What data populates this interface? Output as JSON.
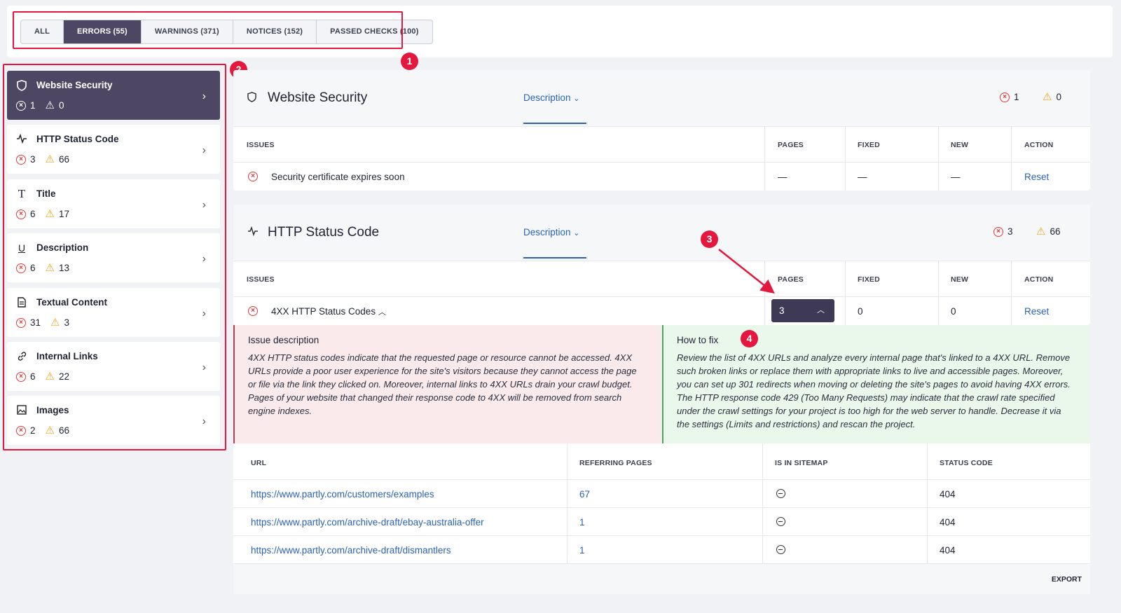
{
  "filter_tabs": [
    {
      "label": "ALL"
    },
    {
      "label": "ERRORS (55)"
    },
    {
      "label": "WARNINGS (371)"
    },
    {
      "label": "NOTICES (152)"
    },
    {
      "label": "PASSED CHECKS (100)"
    }
  ],
  "annotations": [
    "1",
    "2",
    "3",
    "4"
  ],
  "sidebar": {
    "items": [
      {
        "label": "Website Security",
        "icon": "shield-icon",
        "errors": "1",
        "warnings": "0"
      },
      {
        "label": "HTTP Status Code",
        "icon": "pulse-icon",
        "errors": "3",
        "warnings": "66"
      },
      {
        "label": "Title",
        "icon": "title-icon",
        "errors": "6",
        "warnings": "17"
      },
      {
        "label": "Description",
        "icon": "underline-icon",
        "errors": "6",
        "warnings": "13"
      },
      {
        "label": "Textual Content",
        "icon": "document-icon",
        "errors": "31",
        "warnings": "3"
      },
      {
        "label": "Internal Links",
        "icon": "link-icon",
        "errors": "6",
        "warnings": "22"
      },
      {
        "label": "Images",
        "icon": "image-icon",
        "errors": "2",
        "warnings": "66"
      }
    ]
  },
  "columns": {
    "issues": "ISSUES",
    "pages": "PAGES",
    "fixed": "FIXED",
    "new": "NEW",
    "action": "ACTION"
  },
  "panels": [
    {
      "title": "Website Security",
      "description_label": "Description",
      "errors": "1",
      "warnings": "0",
      "issue": {
        "name": "Security certificate expires soon",
        "pages": "—",
        "fixed": "—",
        "new": "—",
        "action": "Reset"
      }
    },
    {
      "title": "HTTP Status Code",
      "description_label": "Description",
      "errors": "3",
      "warnings": "66",
      "issue": {
        "name": "4XX HTTP Status Codes",
        "pages": "3",
        "fixed": "0",
        "new": "0",
        "action": "Reset"
      }
    }
  ],
  "issue_description": {
    "title": "Issue description",
    "lines": [
      "4XX HTTP status codes indicate that the requested page or resource cannot be accessed. 4XX",
      "URLs provide a poor user experience for the site's visitors because they cannot access the page",
      "or file via the link they clicked on. Moreover, internal links to 4XX URLs drain your crawl budget.",
      "Pages of your website that changed their response code to 4XX will be removed from search",
      "engine indexes."
    ]
  },
  "how_to_fix": {
    "title": "How to fix",
    "lines": [
      "Review the list of 4XX URLs and analyze every internal page that's linked to a 4XX URL. Remove",
      "such broken links or replace them with appropriate links to live and accessible pages. Moreover,",
      "you can set up 301 redirects when moving or deleting the site's pages to avoid having 4XX errors.",
      "The HTTP response code 429 (Too Many Requests) may indicate that the crawl rate specified",
      "under the crawl settings for your project is too high for the web server to handle. Decrease it via",
      "the settings (Limits and restrictions) and rescan the project."
    ]
  },
  "url_table": {
    "headers": {
      "url": "URL",
      "referring": "REFERRING PAGES",
      "sitemap": "IS IN SITEMAP",
      "status": "STATUS CODE"
    },
    "rows": [
      {
        "url": "https://www.partly.com/customers/examples",
        "referring": "67",
        "sitemap": "no",
        "status": "404"
      },
      {
        "url": "https://www.partly.com/archive-draft/ebay-australia-offer",
        "referring": "1",
        "sitemap": "no",
        "status": "404"
      },
      {
        "url": "https://www.partly.com/archive-draft/dismantlers",
        "referring": "1",
        "sitemap": "no",
        "status": "404"
      }
    ],
    "export_label": "EXPORT"
  },
  "colors": {
    "accent": "#4d4764",
    "link": "#2b63b3",
    "error": "#e03a3a",
    "warning": "#f0a81e",
    "annotation": "#e4173f"
  }
}
